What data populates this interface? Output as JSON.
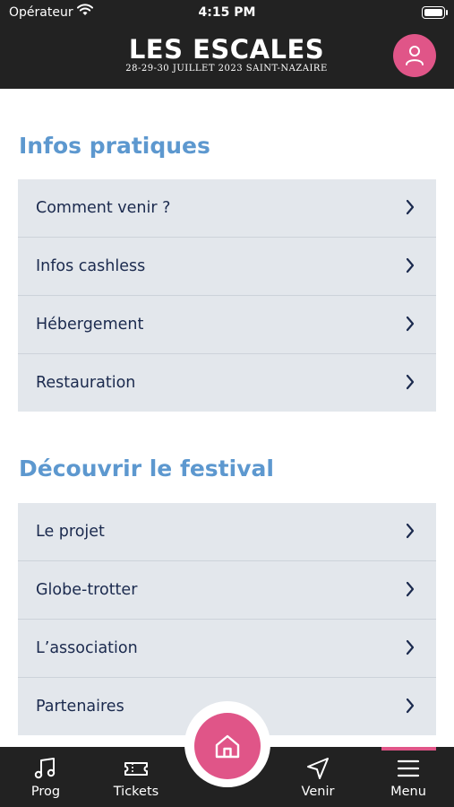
{
  "status_bar": {
    "carrier": "Opérateur",
    "time": "4:15 PM"
  },
  "header": {
    "logo_title": "LES ESCALES",
    "logo_subtitle": "28-29-30 JUILLET 2023   SAINT-NAZAIRE"
  },
  "sections": [
    {
      "title": "Infos pratiques",
      "items": [
        "Comment venir ?",
        "Infos cashless",
        "Hébergement",
        "Restauration"
      ]
    },
    {
      "title": "Découvrir le festival",
      "items": [
        "Le projet",
        "Globe-trotter",
        "L’association",
        "Partenaires"
      ]
    }
  ],
  "tabbar": {
    "tabs": [
      {
        "label": "Prog",
        "icon": "music-note-icon"
      },
      {
        "label": "Tickets",
        "icon": "ticket-icon"
      },
      {
        "label": "Venir",
        "icon": "navigation-arrow-icon"
      },
      {
        "label": "Menu",
        "icon": "hamburger-menu-icon"
      }
    ],
    "active": "Menu"
  },
  "colors": {
    "header_bg": "#222222",
    "accent_pink": "#e05588",
    "section_title": "#5d98cf",
    "list_bg": "#e3e7ec",
    "item_text": "#1b2a4e"
  }
}
